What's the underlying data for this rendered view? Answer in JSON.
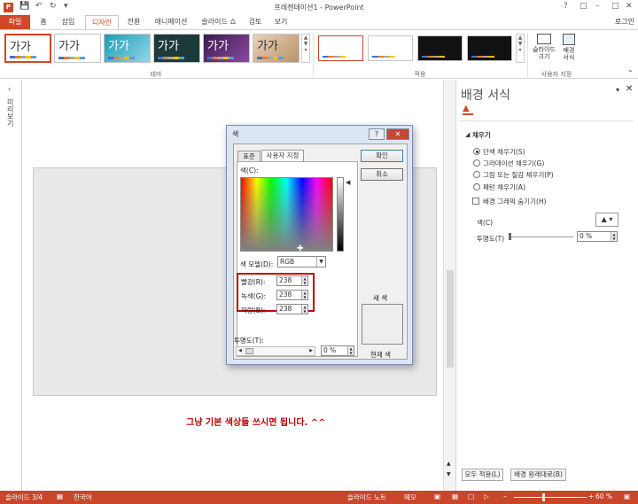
{
  "window": {
    "title": "프레젠테이션1 - PowerPoint",
    "login": "로그인",
    "app_icon": "P"
  },
  "tabs": [
    "파일",
    "홈",
    "삽입",
    "디자인",
    "전환",
    "애니메이션",
    "슬라이드 쇼",
    "검토",
    "보기"
  ],
  "ribbon": {
    "theme_sample": "가가",
    "theme_group_label": "테마",
    "variant_group_label": "적용",
    "customize_group_label": "사용자 지정",
    "slide_size_label": "슬라이드\n크기",
    "format_bg_label": "배경\n서식"
  },
  "left_rail": {
    "vertical_label": "미리보기"
  },
  "slide": {
    "caption": "그냥 기본 색상들 쓰시면 됩니다. ^^"
  },
  "pane": {
    "title": "배경 서식",
    "section": "채우기",
    "options": [
      "단색 채우기(S)",
      "그라데이션 채우기(G)",
      "그림 또는 질감 채우기(P)",
      "패턴 채우기(A)"
    ],
    "hide_bg_graphics": "배경 그래픽 숨기기(H)",
    "color_label": "색(C)",
    "transparency_label": "투명도(T)",
    "transparency_value": "0 %",
    "apply_all": "모두 적용(L)",
    "reset": "배경 원래대로(B)"
  },
  "dialog": {
    "title": "색",
    "help": "?",
    "tab_standard": "표준",
    "tab_custom": "사용자 지정",
    "colors_label": "색(C):",
    "color_model_label": "색 모델(D):",
    "color_model_value": "RGB",
    "red_label": "빨강(R):",
    "green_label": "녹색(G):",
    "blue_label": "파랑(B):",
    "red": "238",
    "green": "238",
    "blue": "238",
    "transparency_label": "투명도(T):",
    "transparency_value": "0 %",
    "ok": "확인",
    "cancel": "취소",
    "new_label": "새 색",
    "current_label": "현재 색"
  },
  "status": {
    "slide": "슬라이드 3/4",
    "language": "한국어",
    "notes": "슬라이드 노트",
    "memo": "메모",
    "zoom": "60 %"
  },
  "colors": {
    "accent": "#d24726",
    "highlight_box": "#c00000",
    "preview": "#eeeeee"
  }
}
